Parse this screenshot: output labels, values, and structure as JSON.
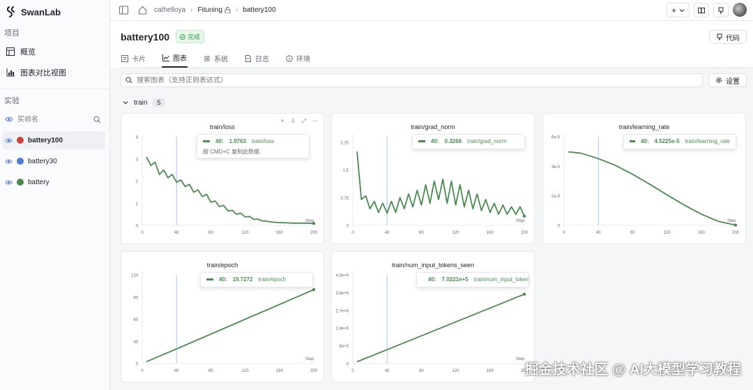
{
  "brand": {
    "name": "SwanLab"
  },
  "sidebar": {
    "project_section": "项目",
    "nav": [
      {
        "label": "概览"
      },
      {
        "label": "图表对比视图"
      }
    ],
    "experiment_section": "实验",
    "search_placeholder": "实验名",
    "experiments": [
      {
        "name": "battery100",
        "color": "#c8433a"
      },
      {
        "name": "battery30",
        "color": "#4e79d6"
      },
      {
        "name": "battery",
        "color": "#4a8a4f"
      }
    ]
  },
  "topbar": {
    "crumbs": [
      "cathelloya",
      "Fituning",
      "battery100"
    ]
  },
  "header": {
    "title": "battery100",
    "status": "完成",
    "code_button": "代码"
  },
  "tabs": [
    {
      "label": "卡片"
    },
    {
      "label": "图表"
    },
    {
      "label": "系统"
    },
    {
      "label": "日志"
    },
    {
      "label": "环境"
    }
  ],
  "toolbar": {
    "search_placeholder": "搜索图表（支持正则表达式）",
    "settings_label": "设置"
  },
  "group": {
    "name": "train",
    "count": "5"
  },
  "charts_meta": {
    "step_label": "Step",
    "line_color": "#4a8a4f",
    "cursor_color": "#a9c7f5",
    "copy_hint": "按 CMD+C 复制此数据"
  },
  "chart_data": [
    {
      "type": "line",
      "title": "train/loss",
      "tooltip": {
        "step": "40:",
        "value": "1.9763",
        "name": "train/loss"
      },
      "xlim": [
        0,
        200
      ],
      "ylim": [
        0,
        4
      ],
      "xticks": [
        "0",
        "40",
        "80",
        "120",
        "160",
        "200"
      ],
      "yticks": [
        "0",
        "1",
        "2",
        "3",
        "4"
      ],
      "ytick_values": [
        0,
        1,
        2,
        3,
        4
      ],
      "x": [
        5,
        10,
        15,
        20,
        25,
        30,
        35,
        40,
        45,
        50,
        55,
        60,
        65,
        70,
        75,
        80,
        85,
        90,
        95,
        100,
        105,
        110,
        115,
        120,
        125,
        130,
        135,
        140,
        145,
        150,
        155,
        160,
        165,
        170,
        175,
        180,
        185,
        190,
        195,
        200
      ],
      "y": [
        3.1,
        2.7,
        2.85,
        2.3,
        2.5,
        2.15,
        2.3,
        1.95,
        2.05,
        1.75,
        1.85,
        1.5,
        1.6,
        1.3,
        1.4,
        1.05,
        1.1,
        0.85,
        0.9,
        0.65,
        0.68,
        0.5,
        0.55,
        0.38,
        0.4,
        0.27,
        0.28,
        0.2,
        0.19,
        0.15,
        0.14,
        0.12,
        0.12,
        0.11,
        0.1,
        0.1,
        0.1,
        0.1,
        0.09,
        0.09
      ]
    },
    {
      "type": "line",
      "title": "train/grad_norm",
      "tooltip": {
        "step": "40:",
        "value": "0.3266",
        "name": "train/grad_norm"
      },
      "xlim": [
        0,
        200
      ],
      "ylim": [
        0,
        2.4
      ],
      "xticks": [
        "0",
        "40",
        "80",
        "120",
        "160",
        "200"
      ],
      "yticks": [
        "0",
        "0.75",
        "1.5",
        "2.25"
      ],
      "ytick_values": [
        0,
        0.75,
        1.5,
        2.25
      ],
      "x": [
        5,
        10,
        15,
        20,
        25,
        30,
        35,
        40,
        45,
        50,
        55,
        60,
        65,
        70,
        75,
        80,
        85,
        90,
        95,
        100,
        105,
        110,
        115,
        120,
        125,
        130,
        135,
        140,
        145,
        150,
        155,
        160,
        165,
        170,
        175,
        180,
        185,
        190,
        195,
        200
      ],
      "y": [
        2.0,
        0.7,
        0.8,
        0.45,
        0.65,
        0.35,
        0.6,
        0.33,
        0.65,
        0.35,
        0.75,
        0.45,
        0.85,
        0.5,
        0.95,
        0.55,
        1.1,
        0.6,
        1.2,
        0.7,
        1.25,
        0.6,
        1.2,
        0.55,
        1.1,
        0.5,
        0.95,
        0.45,
        0.85,
        0.4,
        0.7,
        0.35,
        0.6,
        0.3,
        0.55,
        0.3,
        0.5,
        0.3,
        0.5,
        0.25
      ]
    },
    {
      "type": "line",
      "title": "train/learning_rate",
      "tooltip": {
        "step": "40:",
        "value": "4.5225e-5",
        "name": "train/learning_rate"
      },
      "xlim": [
        0,
        200
      ],
      "ylim": [
        0,
        6e-05
      ],
      "xticks": [
        "0",
        "40",
        "80",
        "120",
        "160",
        "200"
      ],
      "yticks": [
        "0",
        "2e-5",
        "4e-5",
        "6e-5"
      ],
      "ytick_values": [
        0,
        2e-05,
        4e-05,
        6e-05
      ],
      "x": [
        5,
        20,
        40,
        60,
        80,
        100,
        120,
        140,
        160,
        180,
        200
      ],
      "y": [
        4.98e-05,
        4.88e-05,
        4.5225e-05,
        4.06e-05,
        3.46e-05,
        2.78e-05,
        2.07e-05,
        1.38e-05,
        7.6e-06,
        2.7e-06,
        2e-07
      ]
    },
    {
      "type": "line",
      "title": "train/epoch",
      "tooltip": {
        "step": "40:",
        "value": "19.7272",
        "name": "train/epoch"
      },
      "xlim": [
        0,
        200
      ],
      "ylim": [
        0,
        120
      ],
      "xticks": [
        "0",
        "40",
        "80",
        "120",
        "160",
        "200"
      ],
      "yticks": [
        "0",
        "30",
        "60",
        "90",
        "120"
      ],
      "ytick_values": [
        0,
        30,
        60,
        90,
        120
      ],
      "x": [
        5,
        40,
        200
      ],
      "y": [
        2.5,
        19.7272,
        100
      ]
    },
    {
      "type": "line",
      "title": "train/num_input_tokens_seen",
      "tooltip": {
        "step": "40:",
        "value": "7.0221e+5",
        "name": "train/num_input_tokens_seen"
      },
      "xlim": [
        0,
        200
      ],
      "ylim": [
        0,
        4500000
      ],
      "xticks": [
        "0",
        "40",
        "80",
        "120",
        "160",
        "200"
      ],
      "yticks": [
        "0",
        "9e+5",
        "1.8e+6",
        "2.7e+6",
        "3.6e+6",
        "4.5e+6"
      ],
      "ytick_values": [
        0,
        900000,
        1800000,
        2700000,
        3600000,
        4500000
      ],
      "x": [
        5,
        40,
        200
      ],
      "y": [
        90000,
        702210,
        3520000
      ]
    }
  ],
  "watermark": "掘金技术社区 @ AI大模型学习教程"
}
